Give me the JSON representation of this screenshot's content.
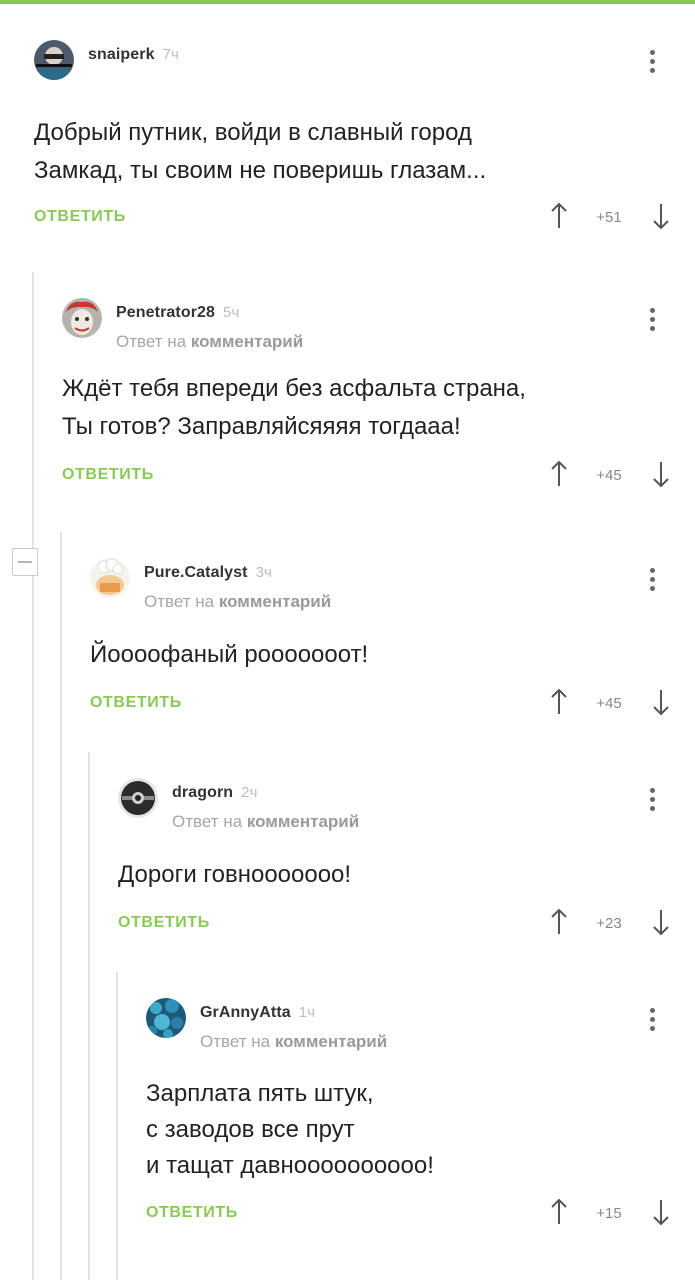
{
  "comments": [
    {
      "user": "snaiperk",
      "time": "7ч",
      "reply_prefix": "",
      "reply_target": "",
      "body": "Добрый путник, войди в славный город\nЗамкад, ты своим не поверишь глазам...",
      "reply_label": "ответить",
      "score": "+51",
      "avatar_icon": "sniper-avatar-icon"
    },
    {
      "user": "Penetrator28",
      "time": "5ч",
      "reply_prefix": "Ответ на",
      "reply_target": "комментарий",
      "body": "Ждёт тебя впереди без асфальта страна,\nТы готов? Заправляйсяяяя тогдааа!",
      "reply_label": "ответить",
      "score": "+45",
      "avatar_icon": "clown-avatar-icon"
    },
    {
      "user": "Pure.Catalyst",
      "time": "3ч",
      "reply_prefix": "Ответ на",
      "reply_target": "комментарий",
      "body": "Йоооофаный рооооооот!",
      "reply_label": "ответить",
      "score": "+45",
      "avatar_icon": "chef-avatar-icon"
    },
    {
      "user": "dragorn",
      "time": "2ч",
      "reply_prefix": "Ответ на",
      "reply_target": "комментарий",
      "body": "Дороги говноооооoo!",
      "reply_label": "ответить",
      "score": "+23",
      "avatar_icon": "dark-sphere-avatar-icon"
    },
    {
      "user": "GrAnnyAtta",
      "time": "1ч",
      "reply_prefix": "Ответ на",
      "reply_target": "комментарий",
      "body": "Зарплата пять штук,\nс заводов все прут\nи тащат давноооооооооо!",
      "reply_label": "ответить",
      "score": "+15",
      "avatar_icon": "blue-stones-avatar-icon"
    }
  ],
  "colors": {
    "accent": "#8ac858",
    "thread_line": "#e3e3e3",
    "muted": "#a6a6a6"
  }
}
